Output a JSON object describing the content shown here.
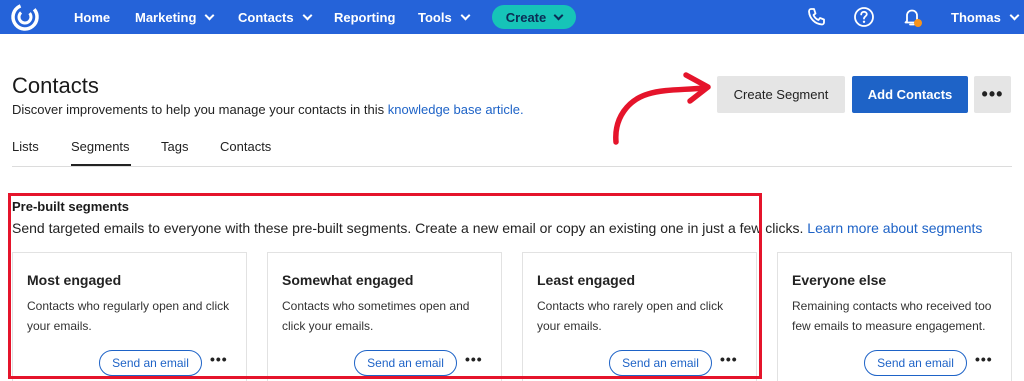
{
  "nav": {
    "items": [
      {
        "label": "Home",
        "has_menu": false
      },
      {
        "label": "Marketing",
        "has_menu": true
      },
      {
        "label": "Contacts",
        "has_menu": true
      },
      {
        "label": "Reporting",
        "has_menu": false
      },
      {
        "label": "Tools",
        "has_menu": true
      }
    ],
    "create_label": "Create",
    "user_name": "Thomas",
    "icons": [
      "phone-icon",
      "help-icon",
      "bell-icon"
    ],
    "colors": {
      "bar": "#2563d9",
      "create": "#16c4b8",
      "notification_dot": "#f7941d"
    }
  },
  "header": {
    "title": "Contacts",
    "subtitle": "Discover improvements to help you manage your contacts in this",
    "subtitle_link": "knowledge base article.",
    "create_segment_label": "Create Segment",
    "add_contacts_label": "Add Contacts",
    "more_label": "•••"
  },
  "tabs": [
    {
      "label": "Lists",
      "active": false
    },
    {
      "label": "Segments",
      "active": true
    },
    {
      "label": "Tags",
      "active": false
    },
    {
      "label": "Contacts",
      "active": false
    }
  ],
  "prebuilt": {
    "title": "Pre-built segments",
    "description": "Send targeted emails to everyone with these pre-built segments. Create a new email or copy an existing one in just a few clicks.",
    "link": "Learn more about segments",
    "cards": [
      {
        "title": "Most engaged",
        "desc": "Contacts who regularly open and click your emails.",
        "button": "Send an email",
        "more": "•••"
      },
      {
        "title": "Somewhat engaged",
        "desc": "Contacts who sometimes open and click your emails.",
        "button": "Send an email",
        "more": "•••"
      },
      {
        "title": "Least engaged",
        "desc": "Contacts who rarely open and click your emails.",
        "button": "Send an email",
        "more": "•••"
      },
      {
        "title": "Everyone else",
        "desc": "Remaining contacts who received too few emails to measure engagement.",
        "button": "Send an email",
        "more": "•••"
      }
    ]
  },
  "annotations": {
    "highlight_color": "#e5142b",
    "arrow_color": "#e5142b"
  }
}
